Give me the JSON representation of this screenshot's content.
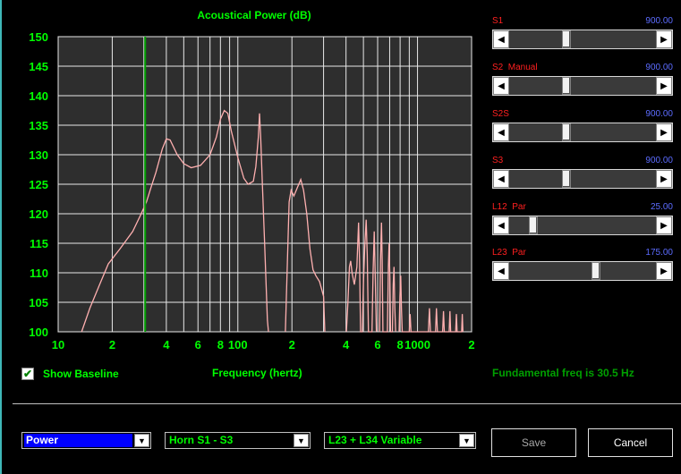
{
  "chart_data": {
    "type": "line",
    "title": "Acoustical Power (dB)",
    "xlabel": "Frequency (hertz)",
    "ylabel": "",
    "x_scale": "log",
    "xlim": [
      10,
      2000
    ],
    "ylim": [
      100,
      150
    ],
    "x_tick_labels": [
      "10",
      "2",
      "4",
      "6",
      "8",
      "100",
      "2",
      "4",
      "6",
      "8",
      "1000",
      "2"
    ],
    "x_tick_values": [
      10,
      20,
      40,
      60,
      80,
      100,
      200,
      400,
      600,
      800,
      1000,
      2000
    ],
    "y_ticks": [
      100,
      105,
      110,
      115,
      120,
      125,
      130,
      135,
      140,
      145,
      150
    ],
    "grid": true,
    "marker_line_x": 30.5,
    "series": [
      {
        "color": "#ffb0b0",
        "points": [
          [
            13.5,
            100
          ],
          [
            15,
            104
          ],
          [
            17,
            108
          ],
          [
            19,
            111.5
          ],
          [
            22,
            114
          ],
          [
            26,
            117
          ],
          [
            29,
            120
          ],
          [
            31,
            122
          ],
          [
            32.5,
            124
          ],
          [
            35,
            127
          ],
          [
            38,
            131
          ],
          [
            40,
            132.7
          ],
          [
            42,
            132.5
          ],
          [
            46,
            130
          ],
          [
            50,
            128.5
          ],
          [
            55,
            127.8
          ],
          [
            62,
            128.2
          ],
          [
            70,
            130
          ],
          [
            76,
            133
          ],
          [
            80,
            136
          ],
          [
            84,
            137.5
          ],
          [
            88,
            137
          ],
          [
            92,
            134
          ],
          [
            100,
            129.5
          ],
          [
            108,
            126
          ],
          [
            114,
            125
          ],
          [
            122,
            125.5
          ],
          [
            126,
            128
          ],
          [
            130,
            133
          ],
          [
            132,
            137
          ],
          [
            134,
            133
          ],
          [
            137,
            125
          ],
          [
            141,
            115
          ],
          [
            146,
            102
          ],
          [
            148,
            100
          ]
        ]
      },
      {
        "color": "#ffb0b0",
        "points": [
          [
            184,
            100
          ],
          [
            188,
            110
          ],
          [
            193,
            122
          ],
          [
            198,
            124
          ],
          [
            205,
            123
          ],
          [
            215,
            124.5
          ],
          [
            224,
            125.8
          ],
          [
            232,
            124
          ],
          [
            242,
            120
          ],
          [
            252,
            114
          ],
          [
            262,
            110.5
          ],
          [
            272,
            109.5
          ],
          [
            285,
            108.5
          ],
          [
            300,
            106
          ],
          [
            305,
            100
          ]
        ]
      },
      {
        "color": "#ffb0b0",
        "points": [
          [
            402,
            100
          ],
          [
            410,
            105
          ],
          [
            418,
            111
          ],
          [
            425,
            112
          ],
          [
            432,
            110
          ],
          [
            445,
            108
          ],
          [
            460,
            111
          ],
          [
            470,
            118.5
          ],
          [
            476,
            112
          ],
          [
            482,
            100
          ],
          [
            493,
            100
          ],
          [
            500,
            108
          ],
          [
            508,
            114
          ],
          [
            518,
            119
          ],
          [
            525,
            113
          ],
          [
            533,
            100
          ],
          [
            558,
            100
          ],
          [
            566,
            110
          ],
          [
            574,
            117
          ],
          [
            582,
            109
          ],
          [
            590,
            100
          ]
        ]
      },
      {
        "color": "#ffb0b0",
        "points": [
          [
            615,
            100
          ],
          [
            622,
            112
          ],
          [
            630,
            118.5
          ],
          [
            636,
            112
          ],
          [
            642,
            100
          ],
          [
            680,
            100
          ],
          [
            688,
            111
          ],
          [
            695,
            115
          ],
          [
            702,
            109
          ],
          [
            708,
            100
          ],
          [
            725,
            100
          ],
          [
            732,
            108
          ],
          [
            740,
            111
          ],
          [
            748,
            104
          ],
          [
            755,
            100
          ]
        ]
      },
      {
        "color": "#ffb0b0",
        "points": [
          [
            790,
            100
          ],
          [
            798,
            106
          ],
          [
            806,
            109.5
          ],
          [
            814,
            104
          ],
          [
            822,
            100
          ],
          [
            900,
            100
          ],
          [
            910,
            103
          ],
          [
            920,
            100
          ],
          [
            1150,
            100
          ],
          [
            1165,
            104
          ],
          [
            1180,
            100
          ],
          [
            1260,
            100
          ],
          [
            1275,
            104
          ],
          [
            1290,
            100
          ],
          [
            1380,
            100
          ],
          [
            1395,
            103.5
          ],
          [
            1410,
            100
          ],
          [
            1500,
            100
          ],
          [
            1515,
            103.5
          ],
          [
            1530,
            100
          ],
          [
            1630,
            100
          ],
          [
            1645,
            103
          ],
          [
            1660,
            100
          ],
          [
            1760,
            100
          ],
          [
            1775,
            103
          ],
          [
            1790,
            100
          ]
        ]
      }
    ]
  },
  "sliders": [
    {
      "label": "S1",
      "value": "900.00",
      "level": 0.38
    },
    {
      "label": "S2  Manual",
      "value": "900.00",
      "level": 0.38
    },
    {
      "label": "S2S",
      "value": "900.00",
      "level": 0.38
    },
    {
      "label": "S3",
      "value": "900.00",
      "level": 0.38
    },
    {
      "label": "L12  Par",
      "value": "25.00",
      "level": 0.14
    },
    {
      "label": "L23  Par",
      "value": "175.00",
      "level": 0.6
    }
  ],
  "baseline": {
    "label": "Show Baseline",
    "checked": true
  },
  "fundamental_text": "Fundamental freq is 30.5 Hz",
  "dropdowns": [
    {
      "value": "Power",
      "text_color": "#ffffff",
      "bg": "#0000ff"
    },
    {
      "value": "Horn S1 - S3",
      "text_color": "#00ff00",
      "bg": "#000000"
    },
    {
      "value": "L23 + L34 Variable",
      "text_color": "#00ff00",
      "bg": "#000000"
    }
  ],
  "buttons": {
    "save": "Save",
    "cancel": "Cancel"
  },
  "colors": {
    "title": "#00ff00",
    "axis_labels": "#00ff00",
    "plot_bg": "#2e2e2e",
    "grid": "#e8e8e8",
    "curve": "#ffb0b0",
    "marker_line": "#00a000"
  },
  "icons": {
    "arrow_left": "◀",
    "arrow_right": "▶",
    "chevron_down": "▼",
    "check": "✔"
  }
}
